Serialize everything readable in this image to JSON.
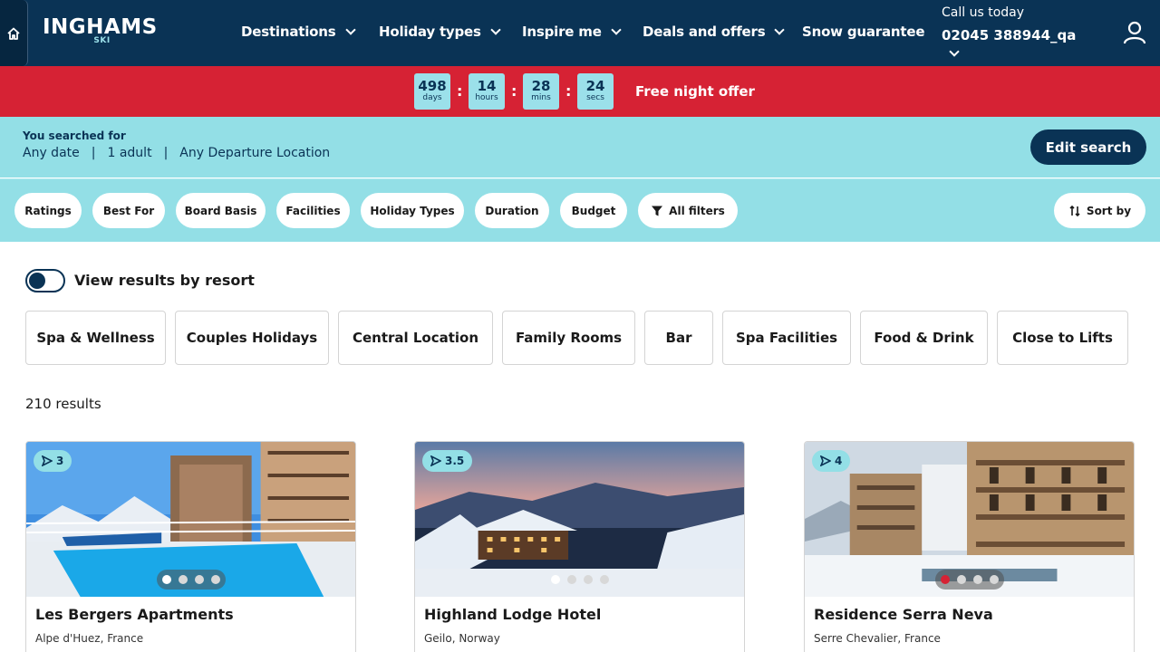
{
  "brand": {
    "name": "INGHAMS",
    "sub": "SKI"
  },
  "nav": {
    "items": [
      {
        "label": "Destinations",
        "has_dropdown": true
      },
      {
        "label": "Holiday types",
        "has_dropdown": true
      },
      {
        "label": "Inspire me",
        "has_dropdown": true
      },
      {
        "label": "Deals and offers",
        "has_dropdown": true
      },
      {
        "label": "Snow guarantee",
        "has_dropdown": false
      }
    ],
    "call_label": "Call us today",
    "call_number": "02045 388944_qa"
  },
  "countdown": {
    "units": [
      {
        "value": "498",
        "unit": "days"
      },
      {
        "value": "14",
        "unit": "hours"
      },
      {
        "value": "28",
        "unit": "mins"
      },
      {
        "value": "24",
        "unit": "secs"
      }
    ],
    "offer": "Free night offer"
  },
  "search": {
    "label": "You searched for",
    "date": "Any date",
    "travellers": "1 adult",
    "departure": "Any Departure Location",
    "edit_label": "Edit search"
  },
  "filters": {
    "pills": [
      "Ratings",
      "Best For",
      "Board Basis",
      "Facilities",
      "Holiday Types",
      "Duration",
      "Budget"
    ],
    "all_filters": "All filters",
    "sort_by": "Sort by"
  },
  "view_toggle": {
    "label": "View results by resort",
    "on": false
  },
  "tags": [
    "Spa & Wellness",
    "Couples Holidays",
    "Central Location",
    "Family Rooms",
    "Bar",
    "Spa Facilities",
    "Food & Drink",
    "Close to Lifts"
  ],
  "results_count": "210 results",
  "cards": [
    {
      "rating": "3",
      "title": "Les Bergers Apartments",
      "location": "Alpe d'Huez, France"
    },
    {
      "rating": "3.5",
      "title": "Highland Lodge Hotel",
      "location": "Geilo, Norway"
    },
    {
      "rating": "4",
      "title": "Residence Serra Neva",
      "location": "Serre Chevalier, France"
    }
  ],
  "colors": {
    "navy": "#0a3355",
    "aqua": "#93dfe6",
    "red": "#d62234"
  }
}
